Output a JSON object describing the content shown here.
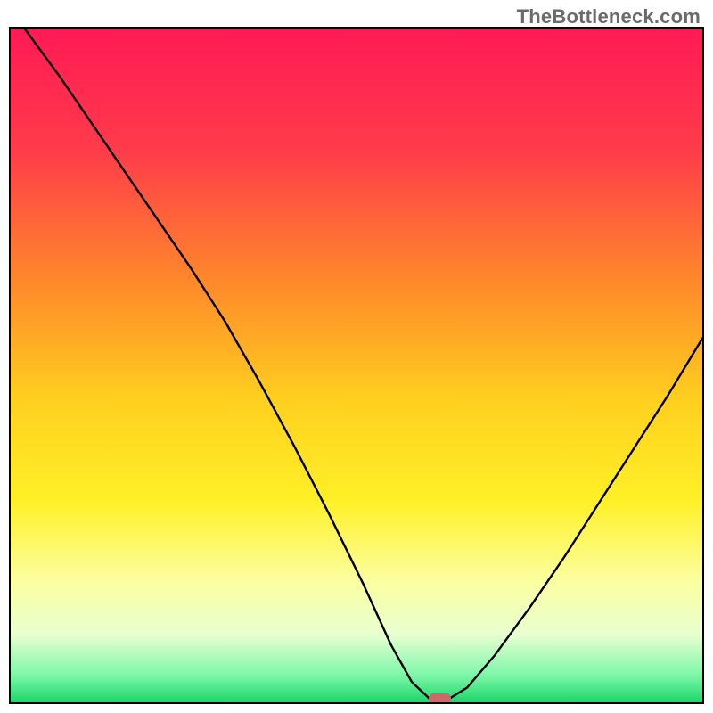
{
  "watermark": "TheBottleneck.com",
  "colors": {
    "frame_border": "#000000",
    "curve": "#000000",
    "marker_fill": "#c96a6a",
    "gradient_stops": [
      {
        "pct": 0,
        "color": "#ff1a55"
      },
      {
        "pct": 18,
        "color": "#ff3b4a"
      },
      {
        "pct": 38,
        "color": "#ff8a2a"
      },
      {
        "pct": 55,
        "color": "#ffcf1f"
      },
      {
        "pct": 70,
        "color": "#fff026"
      },
      {
        "pct": 82,
        "color": "#fbffa0"
      },
      {
        "pct": 90,
        "color": "#e8ffd0"
      },
      {
        "pct": 96,
        "color": "#7cf7a8"
      },
      {
        "pct": 100,
        "color": "#1cd66b"
      }
    ]
  },
  "chart_data": {
    "type": "line",
    "title": "",
    "xlabel": "",
    "ylabel": "",
    "xlim": [
      0,
      100
    ],
    "ylim": [
      0,
      100
    ],
    "note": "Single V-shaped bottleneck curve. x is horizontal position 0–100 (left→right), y is vertical position 0–100 where 0=bottom, 100=top. Values estimated from pixels.",
    "series": [
      {
        "name": "bottleneck-curve",
        "points": [
          {
            "x": 2.0,
            "y": 100.0
          },
          {
            "x": 7.0,
            "y": 93.0
          },
          {
            "x": 13.0,
            "y": 84.0
          },
          {
            "x": 20.0,
            "y": 73.5
          },
          {
            "x": 26.0,
            "y": 64.5
          },
          {
            "x": 31.0,
            "y": 56.5
          },
          {
            "x": 36.0,
            "y": 47.5
          },
          {
            "x": 41.0,
            "y": 38.0
          },
          {
            "x": 46.0,
            "y": 28.0
          },
          {
            "x": 51.0,
            "y": 17.5
          },
          {
            "x": 55.0,
            "y": 8.5
          },
          {
            "x": 58.0,
            "y": 3.0
          },
          {
            "x": 60.5,
            "y": 0.6
          },
          {
            "x": 63.5,
            "y": 0.6
          },
          {
            "x": 66.0,
            "y": 2.2
          },
          {
            "x": 70.0,
            "y": 7.0
          },
          {
            "x": 75.0,
            "y": 14.0
          },
          {
            "x": 80.0,
            "y": 21.5
          },
          {
            "x": 85.0,
            "y": 29.5
          },
          {
            "x": 90.0,
            "y": 37.5
          },
          {
            "x": 95.0,
            "y": 45.5
          },
          {
            "x": 100.0,
            "y": 54.0
          }
        ]
      }
    ],
    "marker": {
      "x": 62.0,
      "y": 0.6,
      "w": 3.2,
      "h": 1.4
    }
  }
}
